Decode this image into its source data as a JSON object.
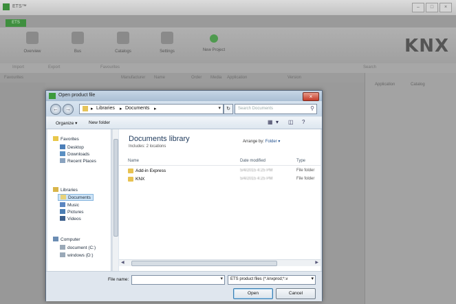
{
  "app": {
    "title": "ETS™",
    "window_buttons": [
      "–",
      "□",
      "×"
    ],
    "file_tab": "ETS",
    "ribbon": [
      {
        "label": "Overview",
        "icon": "overview-icon"
      },
      {
        "label": "Bus",
        "icon": "bus-icon"
      },
      {
        "label": "Catalogs",
        "icon": "catalogs-icon"
      },
      {
        "label": "Settings",
        "icon": "settings-icon"
      },
      {
        "label": "New Project",
        "icon": "new-project-icon"
      }
    ],
    "brand": "KNX",
    "toolbar": [
      "Import",
      "Export",
      "Favourites"
    ],
    "columns": [
      "Favourites",
      "Manufacturer",
      "Name",
      "Order",
      "Media",
      "Application",
      "Version"
    ],
    "right_tabs": [
      "Application",
      "Catalog"
    ],
    "search_label": "Search"
  },
  "dialog": {
    "title": "Open product file",
    "close": "×",
    "breadcrumb": [
      "Libraries",
      "Documents"
    ],
    "search_placeholder": "Search Documents",
    "toolbar": {
      "organize": "Organize ▾",
      "new_folder": "New folder"
    },
    "nav": {
      "favorites": "Favorites",
      "desktop": "Desktop",
      "downloads": "Downloads",
      "recent": "Recent Places",
      "libraries": "Libraries",
      "documents": "Documents",
      "music": "Music",
      "pictures": "Pictures",
      "videos": "Videos",
      "computer": "Computer",
      "drive_c": "document (C:)",
      "drive_d": "windows (D:)"
    },
    "library_title": "Documents library",
    "library_sub": "Includes: 2 locations",
    "arrange_label": "Arrange by:",
    "arrange_value": "Folder ▾",
    "headers": {
      "name": "Name",
      "date": "Date modified",
      "type": "Type"
    },
    "files": [
      {
        "name": "Add-in Express",
        "date": "5/4/2015 4:25 PM",
        "type": "File folder"
      },
      {
        "name": "KNX",
        "date": "5/4/2015 4:25 PM",
        "type": "File folder"
      }
    ],
    "file_name_label": "File name:",
    "file_name_value": "",
    "filter": "ETS product files (*.knxprod;*.v",
    "open": "Open",
    "cancel": "Cancel"
  },
  "colors": {
    "brand_green": "#3f8f3f",
    "dialog_bg": "#dfe6ee",
    "close_red": "#c43b2a"
  }
}
